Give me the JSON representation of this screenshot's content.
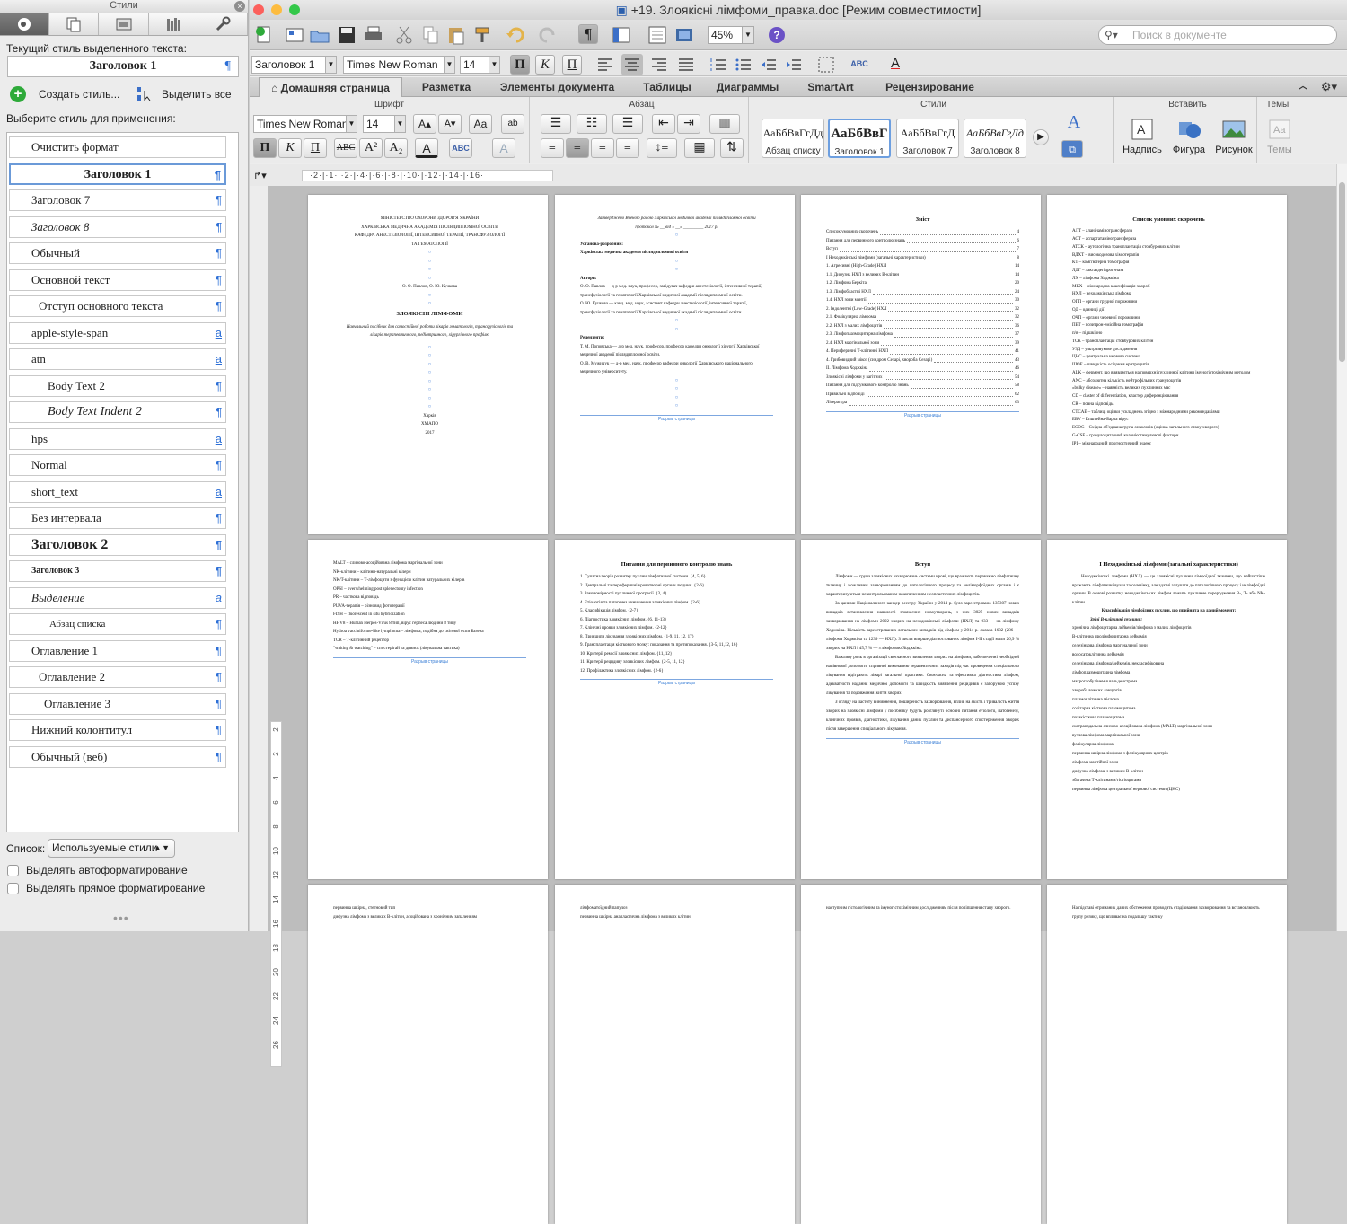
{
  "palette": {
    "title": "Стили",
    "current_label": "Текущий стиль выделенного текста:",
    "current_style": "Заголовок 1",
    "new_style": "Создать стиль...",
    "select_all": "Выделить все",
    "choose_label": "Выберите стиль для применения:",
    "styles": [
      {
        "name": "Очистить формат",
        "mark": ""
      },
      {
        "name": "Заголовок 1",
        "mark": "¶"
      },
      {
        "name": "Заголовок 7",
        "mark": "¶"
      },
      {
        "name": "Заголовок 8",
        "mark": "¶"
      },
      {
        "name": "Обычный",
        "mark": "¶"
      },
      {
        "name": "Основной текст",
        "mark": "¶"
      },
      {
        "name": "Отступ основного текста",
        "mark": "¶"
      },
      {
        "name": "apple-style-span",
        "mark": "a"
      },
      {
        "name": "atn",
        "mark": "a"
      },
      {
        "name": "Body Text 2",
        "mark": "¶"
      },
      {
        "name": "Body Text Indent 2",
        "mark": "¶"
      },
      {
        "name": "hps",
        "mark": "a"
      },
      {
        "name": "Normal",
        "mark": "¶"
      },
      {
        "name": "short_text",
        "mark": "a"
      },
      {
        "name": "Без интервала",
        "mark": "¶"
      },
      {
        "name": "Заголовок 2",
        "mark": "¶"
      },
      {
        "name": "Заголовок 3",
        "mark": "¶"
      },
      {
        "name": "Выделение",
        "mark": "a"
      },
      {
        "name": "Абзац списка",
        "mark": "¶"
      },
      {
        "name": "Оглавление 1",
        "mark": "¶"
      },
      {
        "name": "Оглавление 2",
        "mark": "¶"
      },
      {
        "name": "Оглавление 3",
        "mark": "¶"
      },
      {
        "name": "Нижний колонтитул",
        "mark": "¶"
      },
      {
        "name": "Обычный (веб)",
        "mark": "¶"
      }
    ],
    "list_label": "Список:",
    "list_value": "Используемые стили",
    "check_autoformat": "Выделять автоформатирование",
    "check_direct": "Выделять прямое форматирование"
  },
  "window": {
    "title": "+19. Злоякісні лімфоми_правка.doc [Режим совместимости]",
    "zoom": "45%",
    "search_placeholder": "Поиск в документе",
    "style_value": "Заголовок 1",
    "font_value": "Times New Roman",
    "size_value": "14"
  },
  "ribbon": {
    "tabs": [
      "Домашняя страница",
      "Разметка",
      "Элементы документа",
      "Таблицы",
      "Диаграммы",
      "SmartArt",
      "Рецензирование"
    ],
    "groups": {
      "font": "Шрифт",
      "paragraph": "Абзац",
      "styles": "Стили",
      "insert": "Вставить",
      "themes": "Темы"
    },
    "font_name": "Times New Roman",
    "font_size": "14",
    "style_gallery": [
      {
        "sample": "АаБбВвГгДд",
        "name": "Абзац списку"
      },
      {
        "sample": "АаБбВвГ",
        "name": "Заголовок 1"
      },
      {
        "sample": "АаБбВвГгД",
        "name": "Заголовок 7"
      },
      {
        "sample": "АаБбВвГгДд",
        "name": "Заголовок 8"
      }
    ],
    "insert_items": [
      "Надпись",
      "Фигура",
      "Рисунок"
    ],
    "themes_item": "Темы"
  },
  "ruler": {
    "h": "·2·|·1·|·2·|·4·|·6·|·8·|·10·|·12·|·14·|·16·",
    "v": [
      "2",
      "2",
      "4",
      "6",
      "8",
      "10",
      "12",
      "14",
      "16",
      "18",
      "20",
      "22",
      "24",
      "26"
    ]
  },
  "pages": {
    "p1": {
      "lines": [
        "МІНІСТЕРСТВО ОХОРОНИ ЗДОРОВ'Я УКРАЇНИ",
        "ХАРКІВСЬКА МЕДИЧНА АКАДЕМІЯ ПІСЛЯДИПЛОМНОЇ ОСВІТИ",
        "КАФЕДРА АНЕСТЕЗІОЛОГІЇ, ІНТЕНСИВНОЇ ТЕРАПІЇ, ТРАНСФУЗІОЛОГІЇ",
        "ТА ГЕМАТОЛОГІЇ"
      ],
      "authors": "О. О. Павлов, О. Ю. Кучкова",
      "title": "ЗЛОЯКІСНІ ЛІМФОМИ",
      "subtitle": "Навчальний посібник для самостійної роботи лікарів гематологів, трансфузіологів та лікарів терапевтичного, педіатричного, хірургічного профілю",
      "city": "Харків",
      "pub": "ХМАПО",
      "year": "2017"
    },
    "p2": {
      "approved": "Затверджено Вченою радою Харківської медичної академії післядипломної освіти",
      "protocol": "протокол № __ від « __» _________ 2017 р.",
      "institution_label": "Установа-розробник:",
      "institution": "Харківська медична академія післядипломної освіти",
      "authors_label": "Автори:",
      "author1": "О. О. Павлов — д-р мед. наук, професор, завідувач кафедри анестезіології, інтенсивної терапії, трансфузіології та гематології Харківської медичної академії післядипломної освіти.",
      "author2": "О. Ю. Кучкова — канд. мед. наук, асистент кафедри анестезіології, інтенсивної терапії, трансфузіології та гематології Харківської медичної академії післядипломної освіти.",
      "reviewers_label": "Рецензенти:",
      "rev1": "Т. М. Поповська — д-р мед. наук, професор, професор кафедри онкології хірургії Харківської медичної академії післядипломної освіти.",
      "rev2": "О. В. Мужичук — д-р мед. наук, професор кафедри онкології Харківського національного медичного університету.",
      "break": "Разрыв страницы"
    },
    "p3": {
      "title": "Зміст",
      "toc": [
        [
          "Список умовних скорочень",
          "4"
        ],
        [
          "Питання для первинного контролю знань",
          "6"
        ],
        [
          "Вступ",
          "7"
        ],
        [
          "І Неходжкінські лімфоми (загальні характеристики)",
          "8"
        ],
        [
          "1. Агресивні (High-Grade) НХЛ",
          "14"
        ],
        [
          "1.1. Дифузна НХЛ з великих В-клітин",
          "14"
        ],
        [
          "1.2. Лімфома Беркіта",
          "20"
        ],
        [
          "1.3. Лімфобластні НХЛ",
          "24"
        ],
        [
          "1.4. НХЛ зони мантії",
          "30"
        ],
        [
          "2. Індолентні (Low-Grade) НХЛ",
          "32"
        ],
        [
          "2.1. Фолікулярна лімфома",
          "32"
        ],
        [
          "2.2. НХЛ з малих лімфоцитів",
          "36"
        ],
        [
          "2.3. Лімфоплазмоцитарна лімфома",
          "37"
        ],
        [
          "2.4. НХЛ маргінальної зони",
          "39"
        ],
        [
          "4. Периферичні Т-клітинні НХЛ",
          "41"
        ],
        [
          "4. Грибовидний мікоз (синдром Сезарі, хвороба Сезарі)",
          "43"
        ],
        [
          "ІІ. Лімфома Ходжкіна",
          "46"
        ],
        [
          "Злоякісні лімфоми у вагітних",
          "54"
        ],
        [
          "Питання для підсумкового контролю знань",
          "58"
        ],
        [
          "Правильні відповіді",
          "62"
        ],
        [
          "Література",
          "63"
        ]
      ],
      "break": "Разрыв страницы"
    },
    "p4": {
      "title": "Список умовних скорочень",
      "items": [
        "АЛТ – аланінамінотрансфераза",
        "АСТ – аспартатамінотрансфераза",
        "АТСК – аутологічна трансплантація стовбурових клітин",
        "ВДХТ – високодозова хіміотерапія",
        "КТ – комп'ютерна томографія",
        "ЛДГ – лактатдегідрогеназа",
        "ЛХ – лімфома Ходжкіна",
        "МКХ – міжнародна класифікація хвороб",
        "НХЛ – неходжкінська лімфома",
        "ОГП – органи грудної порожнини",
        "ОД – одиниці дії",
        "ОЧП – органи черевної порожнини",
        "ПЕТ – позитрон-емісійна томографія",
        "п/в – підшкірно",
        "ТСК – трансплантація стовбурових клітин",
        "УЗД – ультразвукове дослідження",
        "ЦНС – центральна нервова система",
        "ШОЕ – швидкість осідання еритроцитів",
        "ALK – фермент, що виявляється на поверхні пухлинної клітини імуногістохімічним методом",
        "ANC – абсолютна кількість нейтрофільних гранулоцитів",
        "«bulky disease» – наявність великих пухлинних мас",
        "CD – claster of differentiation, кластер диференціювання",
        "CR – повна відповідь",
        "CTCAE – таблиці оцінки ускладнень згідно з міжнародними рекомендаціями",
        "EBV – Епштейна-Барра вірус",
        "ECOG – Східна об'єднана група онкологів (оцінка загального стану хворого)",
        "G-CSF – гранулоцитарний колонієстимулюючі фактори",
        "IPI – міжнародний прогностичний індекс"
      ]
    },
    "p5": {
      "items": [
        "MALT – слизово-асоційована лімфома маргінальної зони",
        "NK-клітини – клітини-натуральні кілери",
        "NK/T-клітини – Т-лімфоцити з функцією клітин натуральних кілерів",
        "OPSI – overwhelming post splenectomy infection",
        "PR – часткова відповідь",
        "PUVA-терапія – різновид фототерапії",
        "FISH – fluorescent in situ hybridization",
        "HHV8 – Human Herpes-Virus 8 тип, вірус герпеса людини 8 типу",
        "Hydroa vacciniforme-like lymphoma – лімфома, подібна до світової оспи Базена",
        "TCR – Т-клітинний рецептор",
        "\"waiting & watching\" – спостерігай та дивись (лікувальна тактика)"
      ],
      "break": "Разрыв страницы"
    },
    "p6": {
      "title": "Питання для первинного контролю знань",
      "items": [
        "1. Сучасна теорія розвитку пухлин лімфатичної системи. {4, 5, 6}",
        "2. Центральні та периферичні кровотворні органи людини. {2-6}",
        "3. Закономірності пухлинної прогресії. {3, 4}",
        "4. Етіологія та патогенез виникнення злоякісних лімфом. {2-6}",
        "5. Класифікація лімфом. {2-7}",
        "6. Діагностика злоякісних лімфом. {6, 11-13}",
        "7. Клінічні прояви злоякісних лімфом. {2-12}",
        "8. Принципи лікування злоякісних лімфом. {1-9, 11, 12, 17}",
        "9. Трансплантація кісткового мозку: показання та протипоказання. {3-5, 11,12, 16}",
        "10. Критерії ремісії злоякісних лімфом. {11, 12}",
        "11. Критерії рецидиву злоякісних лімфом. {2-5, 11, 12}",
        "12. Профілактика злоякісних лімфом. {2-6}"
      ],
      "break": "Разрыв страницы"
    },
    "p7": {
      "title": "Вступ",
      "paras": [
        "Лімфоми — група злоякісних захворювань системи крові, що вражають переважно лімфатичну тканину і можливим захворюванням до патологічного процесу та неліморфоїдних органів і є характеризуються неконтрольованим накопиченням неопластичних лімфоцитів.",
        "За даними Національного канцер-реєстру України у 2014 р. було зареєстровано 135307 нових випадків встановлення наявності злоякісних новоутворень, з них 3025 нових випадків захворювання на лімфоми 2092 хворих на неходжкінські лімфоми (НХЛ) та 933 — на лімфому Ходжкіна. Кількість зареєстрованих летальних випадків від лімфом у 2014 р. склала 1632 (286 — лімфома Ходжкіна та 1239 — НХЛ). З числа вперше діагностованих лімфом І-ІІ стадії мали 26,9 % хворих на НХЛ і 45,7 % — з лімфомою Ходжкіна.",
        "Важливу роль в організації своєчасного виявлення хворих на лімфоми, забезпеченні необхідної напівнової допомоги, сприянні виконанню терапевтичних заходів під час проведення спеціального лікування відіграють лікарі загальної практики. Своєчасна та ефективна діагностика лімфом, адекватність надання медичної допомоги та швидкість виявлення рецидивів є запорукою успіху лікування та подовження життя хворих.",
        "З огляду на частоту виникнення, поширеність захворювання, вплив на якість і тривалість життя хворих на злоякісні лімфоми у посібнику будуть розглянуті основні питання етіології, патогенезу, клінічних проявів, діагностики, лікування даних пухлин та диспансерного спостереження хворих після завершення спеціального лікування."
      ],
      "break": "Разрыв страницы"
    },
    "p8": {
      "title": "І Неходжкінські лімфоми (загальні характеристики)",
      "intro": "Неходжкінські лімфоми (НХЛ) — це злоякісні пухлини лімфоїдної тканини, що найчастіше вражають лімфатичні вузли та селезінку, але здатні залучати до патологічного процесу і нелімфоїдні органи. В основі розвитку неходжкінських лімфом лежить пухлинне переродження В-, Т- або NK-клітин.",
      "subtitle": "Класифікація лімфоїдних пухлин, що прийнята на даний момент:",
      "group": "Зрілі В-клітинні пухлини:",
      "items": [
        "хронічна лімфоцитарна лейкемія/лімфома з малих лімфоцитів",
        "В-клітинна пролімфоцитарна лейкемія",
        "селезінкова лімфома маргінальної зони",
        "волосатоклітинна лейкемія",
        "селезінкова лімфома/лейкемія, некласифікована",
        "лімфоплазмоцитарна лімфома",
        "макроглобулінемія вальденстрема",
        "хвороба важких ланцюгів",
        "плазмоклітинна мієлома",
        "солітарна кісткова плазмоцитома",
        "позакісткова плазмоцитома",
        "екстранодальна слизово-асоційована лімфома (MALT) маргінальної зони",
        "вузлова лімфома маргінальної зони",
        "фолікулярна лімфома",
        "первинна шкірна лімфома з фолікулярних центрів",
        "лімфома мантійної зони",
        "дифузна лімфома з великих В-клітин",
        "збагачена Т-клітинами/гістіоцитами",
        "первинна лімфома центральної нервової системи (ЦНС)"
      ]
    },
    "p9": {
      "lines": [
        "первинна шкірна, стегновий тип",
        "дифузна лімфома з великих В-клітин, асоційована з хронічним запаленням"
      ]
    },
    "p10": {
      "lines": [
        "лімфоматоїдний папулоз",
        "первинна шкірна анапластична лімфома з великих клітин"
      ]
    },
    "p11": {
      "lines": [
        "наступним гістологічним та імуногістохімічним дослідженням після поліпшення стану хворого."
      ]
    },
    "p12": {
      "lines": [
        "На підставі отриманих даних обстеження проводить стадіювання захворювання та встановлюють групу ризику, що впливає на подальшу тактику"
      ]
    }
  }
}
